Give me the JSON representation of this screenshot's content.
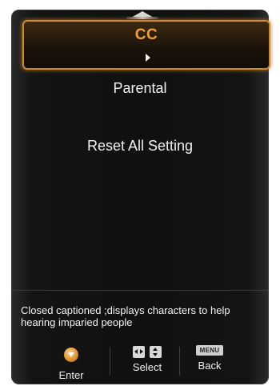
{
  "menu": {
    "items": [
      {
        "label": "CC",
        "selected": true
      },
      {
        "label": "Parental",
        "selected": false
      },
      {
        "label": "Reset All Setting",
        "selected": false
      }
    ]
  },
  "help": {
    "text": "Closed captioned ;displays characters to help hearing imparied people"
  },
  "footer": {
    "enter_label": "Enter",
    "select_label": "Select",
    "back_label": "Back",
    "back_key": "MENU"
  },
  "colors": {
    "accent": "#f0a030",
    "background": "#101010",
    "text": "#f2f2f2"
  },
  "icons": [
    "up-arrow-icon",
    "right-arrow-icon",
    "enter-icon",
    "left-right-icon",
    "up-down-icon",
    "menu-key-icon"
  ]
}
